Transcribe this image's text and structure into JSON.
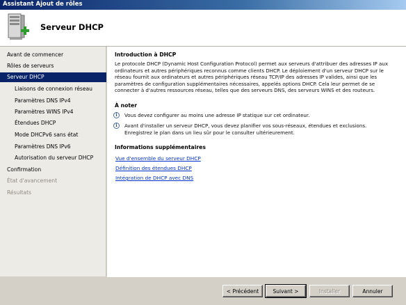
{
  "window": {
    "title": "Assistant Ajout de rôles"
  },
  "header": {
    "title": "Serveur DHCP"
  },
  "sidebar": {
    "items": [
      {
        "label": "Avant de commencer"
      },
      {
        "label": "Rôles de serveurs"
      },
      {
        "label": "Serveur DHCP"
      },
      {
        "label": "Liaisons de connexion réseau"
      },
      {
        "label": "Paramètres DNS IPv4"
      },
      {
        "label": "Paramètres WINS IPv4"
      },
      {
        "label": "Étendues DHCP"
      },
      {
        "label": "Mode DHCPv6 sans état"
      },
      {
        "label": "Paramètres DNS IPv6"
      },
      {
        "label": "Autorisation du serveur DHCP"
      },
      {
        "label": "Confirmation"
      },
      {
        "label": "État d'avancement"
      },
      {
        "label": "Résultats"
      }
    ]
  },
  "content": {
    "intro_title": "Introduction à DHCP",
    "intro_lines": [
      "Le protocole DHCP (Dynamic Host Configuration Protocol) permet aux serveurs d'attribuer des adresses IP aux",
      "ordinateurs et autres périphériques reconnus comme clients DHCP. Le déploiement d'un serveur DHCP sur le",
      "réseau fournit aux ordinateurs et autres périphériques réseau TCP/IP des adresses IP valides, ainsi que les",
      "paramètres de configuration supplémentaires nécessaires, appelés options DHCP. Cela leur permet de se",
      "connecter à d'autres ressources réseau, telles que des serveurs DNS, des serveurs WINS et des routeurs."
    ],
    "note_title": "À noter",
    "notes": [
      {
        "lines": [
          "Vous devez configurer au moins une adresse IP statique sur cet ordinateur."
        ]
      },
      {
        "lines": [
          "Avant d'installer un serveur DHCP, vous devez planifier vos sous-réseaux, étendues et exclusions.",
          "Enregistrez le plan dans un lieu sûr pour le consulter ultérieurement."
        ]
      }
    ],
    "more_title": "Informations supplémentaires",
    "links": [
      "Vue d'ensemble du serveur DHCP",
      "Définition des étendues DHCP",
      "Intégration de DHCP avec DNS"
    ]
  },
  "footer": {
    "prev_label": "< Précédent",
    "next_label": "Suivant >",
    "install_label": "Installer",
    "cancel_label": "Annuler"
  },
  "colors": {
    "selected_bg": "#0a246a",
    "link": "#0033cc",
    "sidebar_bg": "#ecebe6"
  }
}
